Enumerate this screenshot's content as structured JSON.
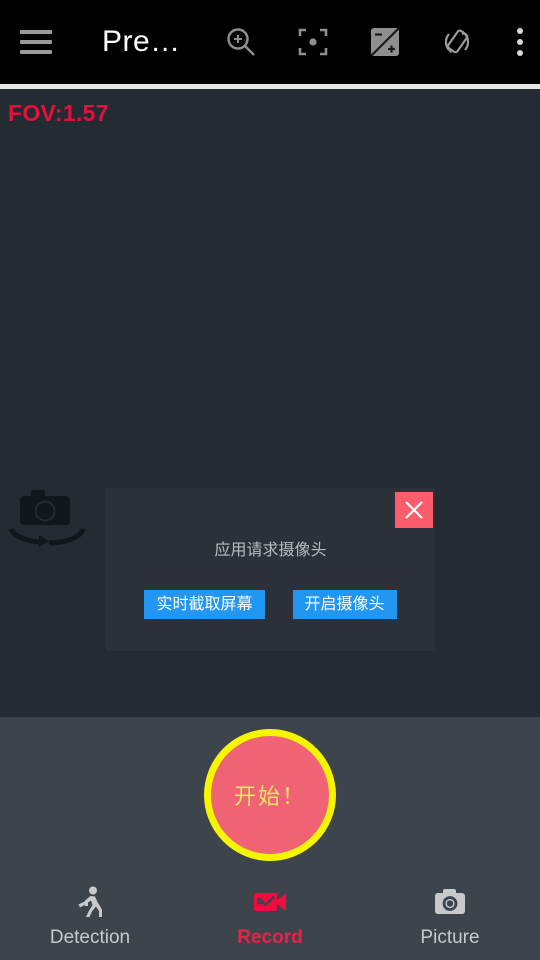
{
  "topbar": {
    "menu_icon": "hamburger-menu-icon",
    "title": "Pre…",
    "icons": [
      {
        "name": "zoom-in-icon",
        "label": "Zoom"
      },
      {
        "name": "focus-target-icon",
        "label": "Focus"
      },
      {
        "name": "exposure-compensation-icon",
        "label": "Exposure"
      },
      {
        "name": "screen-rotation-icon",
        "label": "Rotate"
      },
      {
        "name": "overflow-menu-icon",
        "label": "More options"
      }
    ]
  },
  "preview": {
    "fov_label": "FOV:1.57",
    "fov_color": "#e4113b",
    "switch_camera_icon": "switch-camera-icon",
    "background_color": "#242b33"
  },
  "dialog": {
    "message": "应用请求摄像头",
    "close_label": "×",
    "close_color": "#fc5c6c",
    "button_color": "#2196f3",
    "buttons": [
      {
        "label": "实时截取屏幕"
      },
      {
        "label": "开启摄像头"
      }
    ]
  },
  "start_button": {
    "label": "开始！",
    "fill_color": "#ef6375",
    "ring_color": "#f5f500",
    "text_color": "#f2e36a"
  },
  "tabbar": {
    "active_color": "#e8234a",
    "inactive_color": "#c8c9cb",
    "tabs": [
      {
        "label": "Detection",
        "icon": "running-person-icon",
        "active": false
      },
      {
        "label": "Record",
        "icon": "video-camera-check-icon",
        "active": true
      },
      {
        "label": "Picture",
        "icon": "photo-camera-icon",
        "active": false
      }
    ]
  }
}
